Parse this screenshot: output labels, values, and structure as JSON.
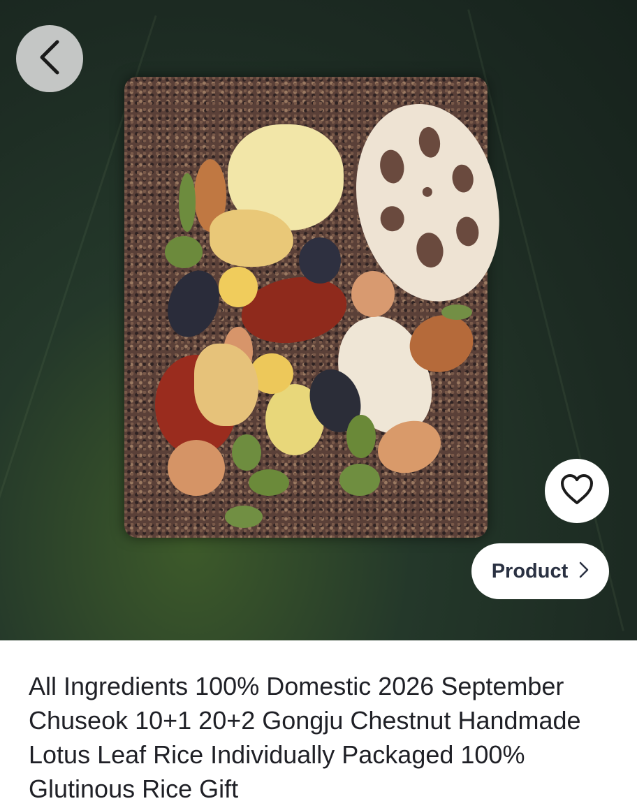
{
  "hero": {
    "image_description_icon": "product-photo",
    "back_icon": "chevron-left-icon",
    "favorite_icon": "heart-outline-icon",
    "product_button": {
      "label": "Product",
      "icon": "chevron-right-icon"
    }
  },
  "product": {
    "title": "All Ingredients 100% Domestic 2026 September Chuseok 10+1 20+2 Gongju Chestnut Handmade Lotus Leaf Rice Individually Packaged 100% Glutinous Rice Gift"
  },
  "colors": {
    "title_text": "#1f2026",
    "button_text": "#2a3142",
    "back_button_bg": "#d7d7d7"
  }
}
